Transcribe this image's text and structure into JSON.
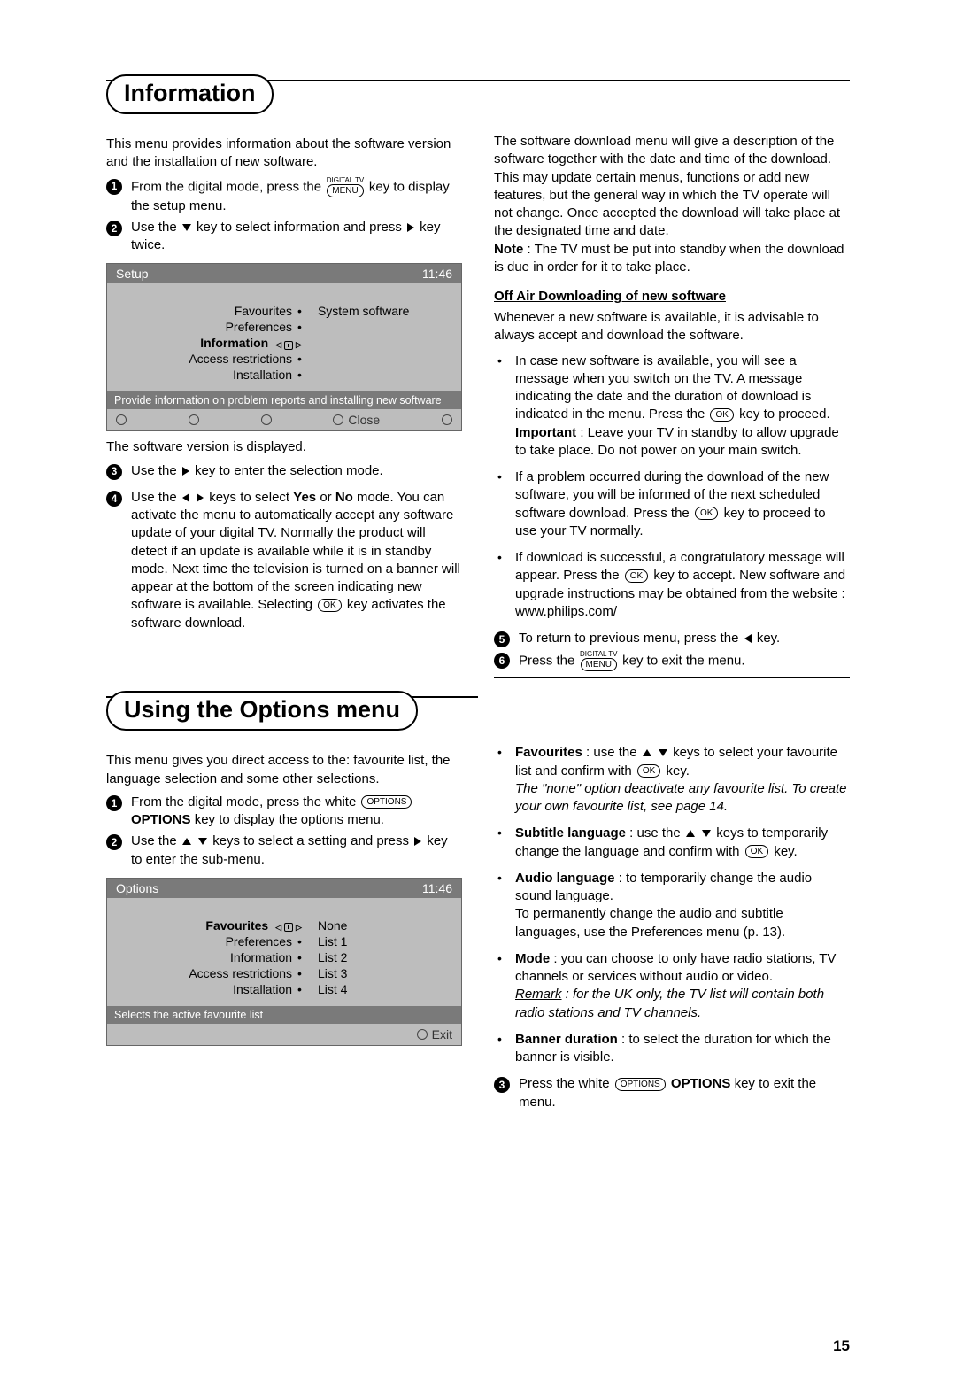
{
  "page_number": "15",
  "section1": {
    "title": "Information",
    "intro": "This menu provides information about the software version and the installation of new software.",
    "step1_a": "From the digital mode, press the ",
    "step1_key_top": "DIGITAL TV",
    "step1_key": "MENU",
    "step1_b": " key to display the setup menu.",
    "step2_a": "Use the ",
    "step2_b": " key to select information and press ",
    "step2_c": " key twice.",
    "after_menu": "The software version is displayed.",
    "step3_a": "Use the ",
    "step3_b": " key to enter the selection mode.",
    "step4_a": "Use the ",
    "step4_b": " keys to select ",
    "step4_yes": "Yes",
    "step4_or": " or ",
    "step4_no": "No",
    "step4_c": " mode. You can activate the menu to automatically accept any software update of your digital TV. Normally the product will detect if an update is available while it is in standby mode. Next time the television is turned on a banner will appear at the bottom of the screen indicating new software is available. Selecting ",
    "step4_key": "OK",
    "step4_d": " key activates the software download."
  },
  "menu1": {
    "title": "Setup",
    "time": "11:46",
    "items": [
      "Favourites",
      "Preferences",
      "Information",
      "Access restrictions",
      "Installation"
    ],
    "right": "System software",
    "hint": "Provide information on problem reports and installing new software",
    "close": "Close"
  },
  "right1": {
    "p1": "The software download menu will give a description of the software together with the date and time of the download. This may update certain menus, functions or add new features, but the general way in which the TV operate will not change. Once accepted the download will take place at the designated time and date.",
    "note_label": "Note",
    "note_text": " : The TV must be put into standby when the download is due in order for it to take place.",
    "subhead": "Off Air Downloading of new software",
    "p2": "Whenever a new software is available, it is advisable to always accept and download the software.",
    "b1_a": "In case new software is available, you will see a message when you switch on the TV. A message indicating the date and the duration of download is indicated in the menu. Press the ",
    "b1_key": "OK",
    "b1_b": " key to proceed. ",
    "b1_imp": "Important",
    "b1_c": " : Leave your TV in standby to allow upgrade to take place. Do not power on your main switch.",
    "b2_a": "If a problem occurred during the download of the new software, you will be informed of the next scheduled software download. Press the ",
    "b2_key": "OK",
    "b2_b": " key to proceed to use your TV normally.",
    "b3_a": "If download is successful, a congratulatory message will appear. Press the ",
    "b3_key": "OK",
    "b3_b": " key to accept. New software and upgrade instructions may be obtained from the website : www.philips.com/",
    "step5_a": "To return to previous menu, press the ",
    "step5_b": " key.",
    "step6_a": "Press the ",
    "step6_key_top": "DIGITAL TV",
    "step6_key": "MENU",
    "step6_b": " key to exit the menu."
  },
  "section2": {
    "title": "Using the Options menu",
    "intro": "This menu gives you direct access to the: favourite list, the language selection and some other selections.",
    "step1_a": "From the digital mode, press the white ",
    "step1_key": "OPTIONS",
    "step1_bold": "OPTIONS",
    "step1_b": " key to display the options menu.",
    "step2_a": "Use the ",
    "step2_b": " keys to select a setting and press ",
    "step2_c": " key to enter the sub-menu."
  },
  "menu2": {
    "title": "Options",
    "time": "11:46",
    "items": [
      "Favourites",
      "Preferences",
      "Information",
      "Access restrictions",
      "Installation"
    ],
    "right": [
      "None",
      "List 1",
      "List 2",
      "List 3",
      "List 4"
    ],
    "hint": "Selects the active favourite list",
    "exit": "Exit"
  },
  "right2": {
    "fav_label": "Favourites",
    "fav_a": " : use the ",
    "fav_b": " keys to select your favourite list and confirm with ",
    "fav_key": "OK",
    "fav_c": " key.",
    "fav_italic": "The \"none\" option deactivate any favourite list. To create your own favourite list, see page 14.",
    "sub_label": "Subtitle language",
    "sub_a": " : use the ",
    "sub_b": " keys to temporarily change the language and confirm with ",
    "sub_key": "OK",
    "sub_c": " key.",
    "aud_label": "Audio language",
    "aud_a": " : to temporarily change the audio sound language.",
    "aud_b": "To permanently change the audio and subtitle languages, use the Preferences menu (p. 13).",
    "mode_label": "Mode",
    "mode_a": " : you can choose to only have radio stations, TV channels or services without audio or video.",
    "mode_remark_label": "Remark",
    "mode_remark": " : for the UK only, the TV list will contain both radio stations and TV channels.",
    "ban_label": "Banner duration",
    "ban_a": " : to select the duration for which the banner is visible.",
    "step3_a": "Press the white ",
    "step3_key": "OPTIONS",
    "step3_bold": "OPTIONS",
    "step3_b": " key to exit the menu."
  }
}
